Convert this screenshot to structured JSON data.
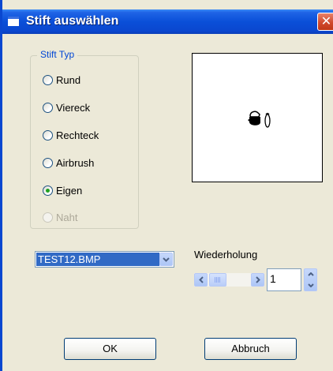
{
  "window": {
    "title": "Stift auswählen",
    "close_glyph": "✕",
    "icon": "window-icon"
  },
  "pen_type": {
    "legend": "Stift Typ",
    "options": [
      {
        "label": "Rund",
        "checked": false,
        "enabled": true
      },
      {
        "label": "Viereck",
        "checked": false,
        "enabled": true
      },
      {
        "label": "Rechteck",
        "checked": false,
        "enabled": true
      },
      {
        "label": "Airbrush",
        "checked": false,
        "enabled": true
      },
      {
        "label": "Eigen",
        "checked": true,
        "enabled": true
      },
      {
        "label": "Naht",
        "checked": false,
        "enabled": false
      }
    ]
  },
  "preview": {
    "content": "brush-icon"
  },
  "file_combo": {
    "value": "TEST12.BMP"
  },
  "repeat": {
    "label": "Wiederholung",
    "value": "1"
  },
  "buttons": {
    "ok": "OK",
    "cancel": "Abbruch"
  },
  "colors": {
    "titlebar": "#0a4fd8",
    "selection": "#316ac5",
    "group_legend": "#0046d5",
    "radio_dot": "#21a121",
    "close_button": "#d0492e"
  }
}
